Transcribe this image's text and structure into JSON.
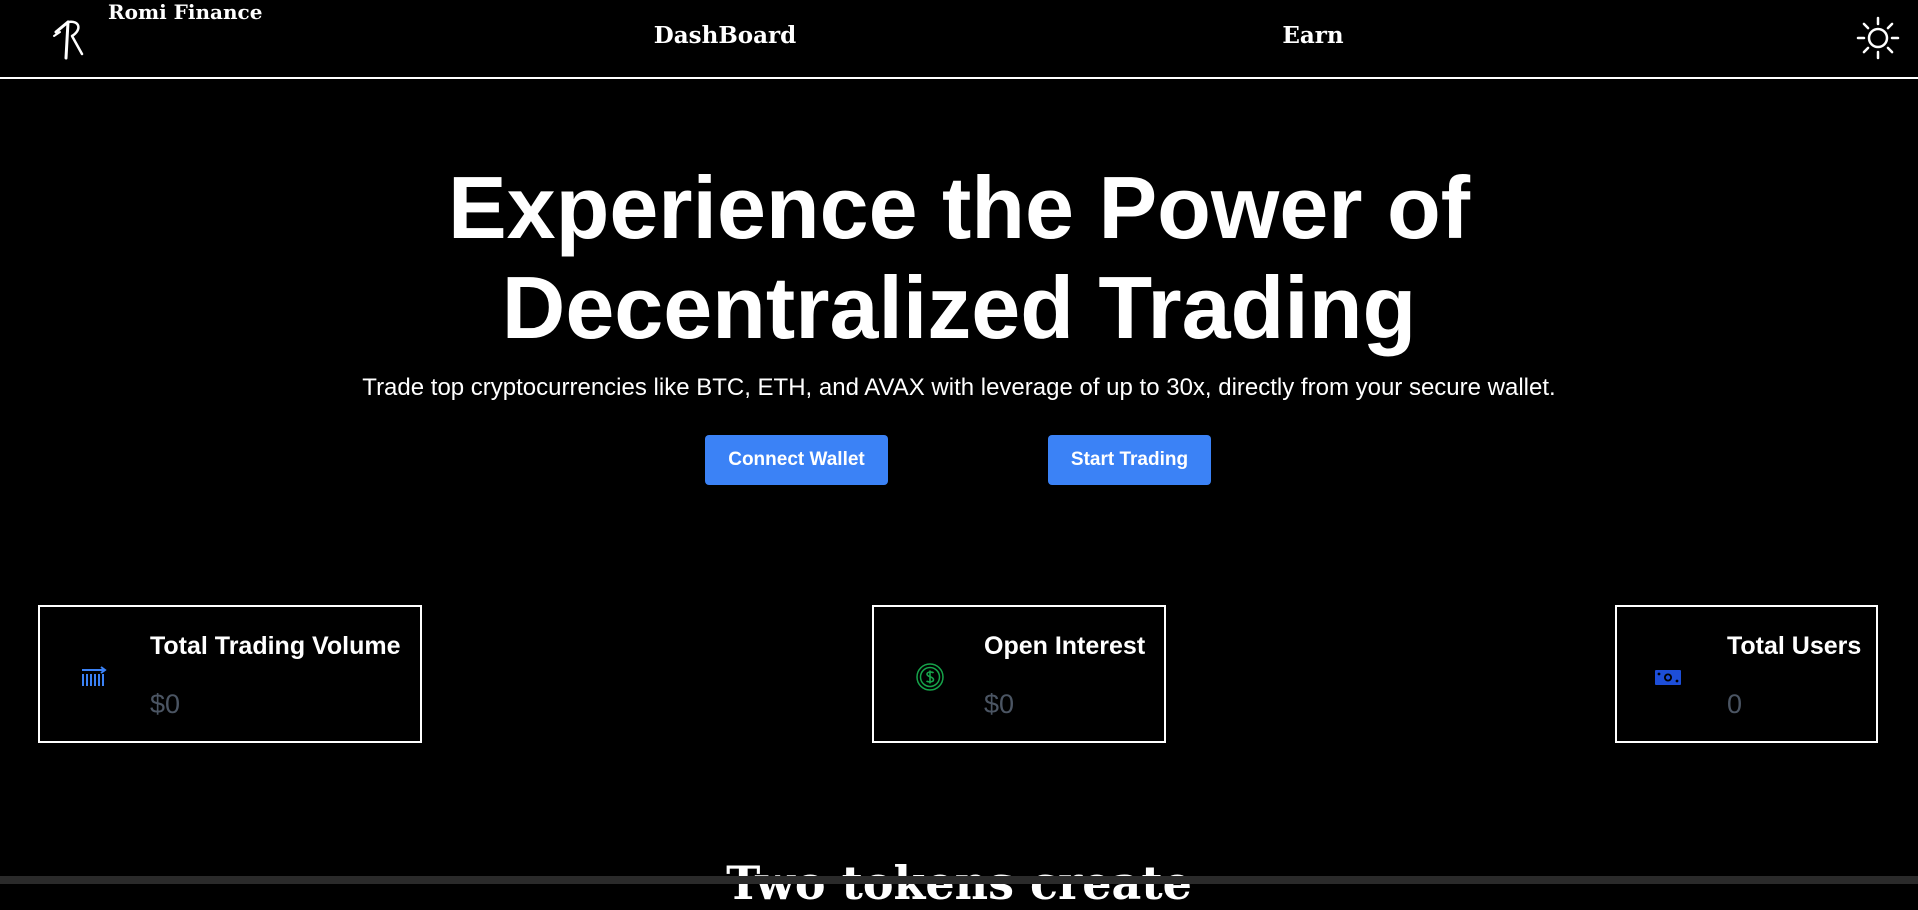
{
  "header": {
    "brand_name": "Romi Finance",
    "logo_icon": "romi-logo-icon",
    "nav": [
      {
        "label": "DashBoard"
      },
      {
        "label": "Earn"
      }
    ],
    "theme_icon": "sun-icon"
  },
  "hero": {
    "title_line1": "Experience the Power of",
    "title_line2": "Decentralized Trading",
    "subtitle": "Trade top cryptocurrencies like BTC, ETH, and AVAX with leverage of up to 30x, directly from your secure wallet.",
    "connect_label": "Connect Wallet",
    "trade_label": "Start Trading",
    "button_color": "#3b82f6"
  },
  "stats": [
    {
      "label": "Total Trading Volume",
      "value": "$0",
      "icon": "volume-bars-icon",
      "icon_color": "#3b82f6"
    },
    {
      "label": "Open Interest",
      "value": "$0",
      "icon": "dollar-coin-icon",
      "icon_color": "#16a34a"
    },
    {
      "label": "Total Users",
      "value": "0",
      "icon": "money-bill-icon",
      "icon_color": "#1d4ed8"
    }
  ],
  "section": {
    "heading": "Two tokens create"
  }
}
